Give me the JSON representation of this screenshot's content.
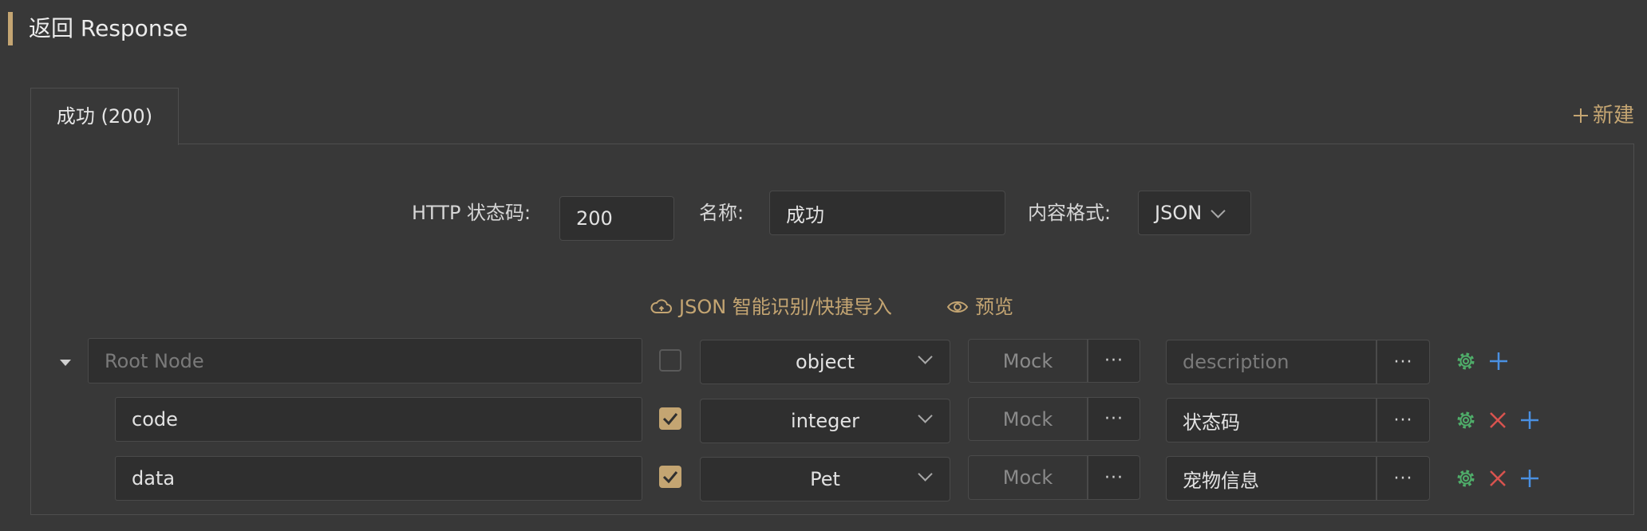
{
  "section": {
    "title": "返回 Response"
  },
  "tabs": [
    {
      "label": "成功 (200)"
    }
  ],
  "new_button": {
    "label": "新建"
  },
  "form": {
    "http_status_label": "HTTP 状态码:",
    "http_status_value": "200",
    "name_label": "名称:",
    "name_value": "成功",
    "format_label": "内容格式:",
    "format_value": "JSON"
  },
  "actions": {
    "import_label": "JSON 智能识别/快捷导入",
    "preview_label": "预览"
  },
  "schema_rows": [
    {
      "name": "",
      "name_placeholder": "Root Node",
      "required": false,
      "type": "object",
      "mock_placeholder": "Mock",
      "more": "···",
      "description": "",
      "description_placeholder": "description"
    },
    {
      "name": "code",
      "required": true,
      "type": "integer",
      "mock_placeholder": "Mock",
      "more": "···",
      "description": "状态码"
    },
    {
      "name": "data",
      "required": true,
      "type": "Pet",
      "mock_placeholder": "Mock",
      "more": "···",
      "description": "宠物信息"
    }
  ],
  "colors": {
    "background": "#383838",
    "accent": "#c4a572",
    "settings_icon": "#4fae6a",
    "delete_icon": "#d9534f",
    "add_icon": "#4a90e2"
  },
  "icons": {
    "expand": "caret-down-icon",
    "new": "plus-icon",
    "import": "cloud-icon",
    "preview": "eye-icon",
    "settings": "gear-icon",
    "delete": "close-icon",
    "add": "plus-icon"
  }
}
